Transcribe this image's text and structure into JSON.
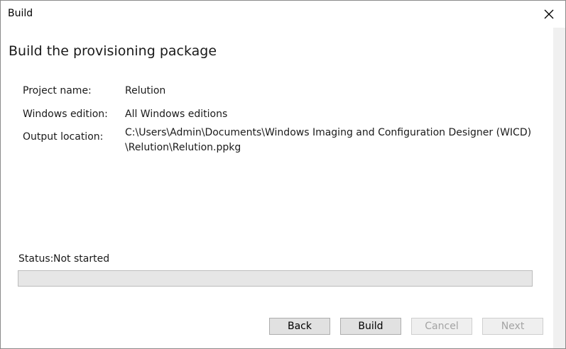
{
  "window": {
    "title": "Build"
  },
  "heading": "Build the provisioning package",
  "fields": {
    "project_name": {
      "label": "Project name:",
      "value": "Relution"
    },
    "windows_edition": {
      "label": "Windows edition:",
      "value": "All Windows editions"
    },
    "output_location": {
      "label": "Output location:",
      "value_line1": "C:\\Users\\Admin\\Documents\\Windows Imaging and Configuration Designer (WICD)",
      "value_line2": "\\Relution\\Relution.ppkg"
    }
  },
  "status": {
    "label": "Status:",
    "value": "Not started",
    "progress_percent": 0
  },
  "buttons": {
    "back": {
      "label": "Back",
      "enabled": true
    },
    "build": {
      "label": "Build",
      "enabled": true
    },
    "cancel": {
      "label": "Cancel",
      "enabled": false
    },
    "next": {
      "label": "Next",
      "enabled": false
    }
  },
  "icons": {
    "close": "close-icon"
  },
  "colors": {
    "progress_track": "#e6e6e6",
    "button_face": "#e1e1e1",
    "disabled_text": "#a3a3a3"
  }
}
